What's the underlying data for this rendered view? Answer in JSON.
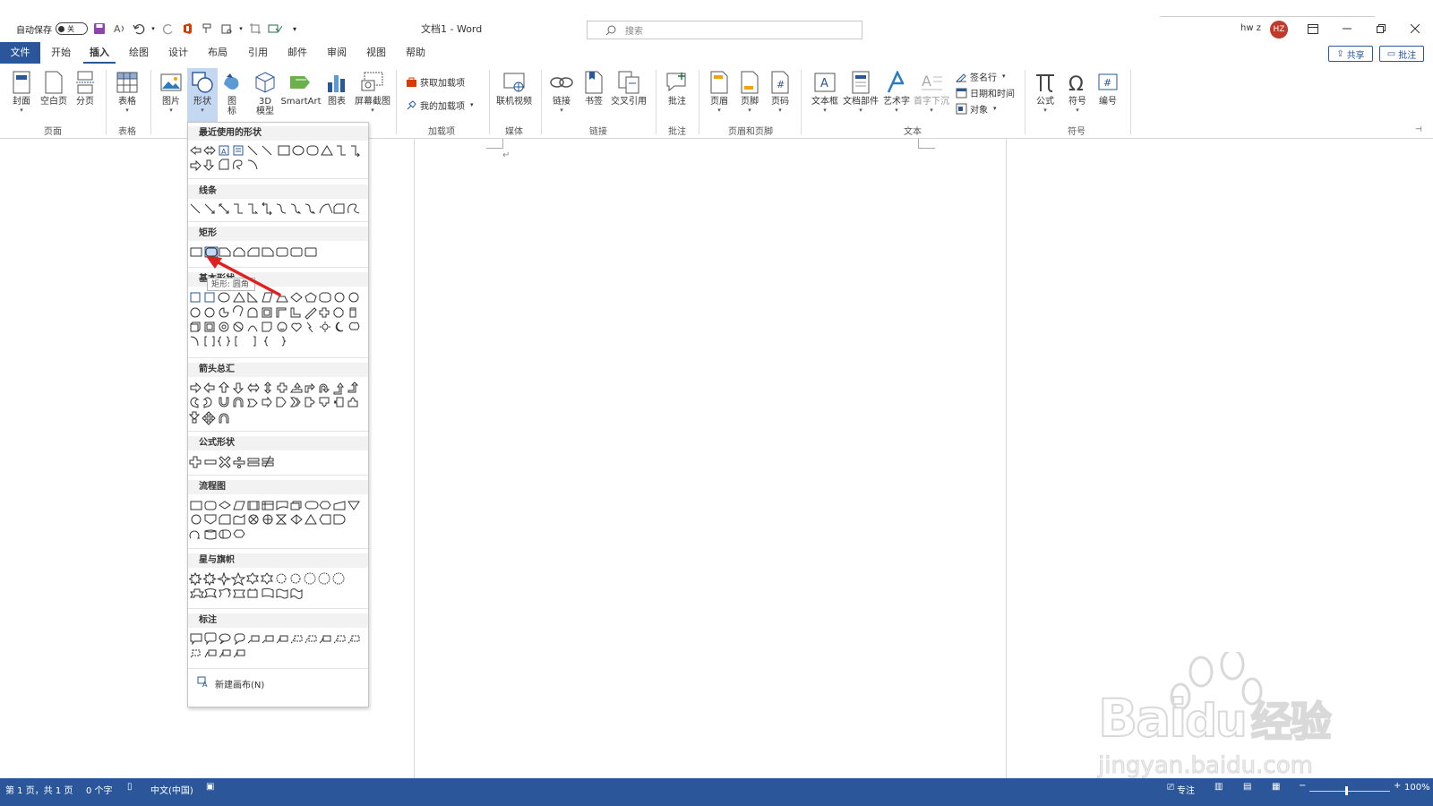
{
  "title_bar": {
    "autosave_label": "自动保存",
    "autosave_state": "关",
    "doc_title": "文档1 - Word",
    "search_placeholder": "搜索",
    "user_name": "hw z",
    "user_initials": "HZ",
    "avatar_color": "#c0392b"
  },
  "tabs": [
    "文件",
    "开始",
    "插入",
    "绘图",
    "设计",
    "布局",
    "引用",
    "邮件",
    "审阅",
    "视图",
    "帮助"
  ],
  "active_tab": "插入",
  "top_buttons": {
    "share": "共享",
    "comments": "批注"
  },
  "ribbon": {
    "pages": {
      "cover": "封面",
      "blank": "空白页",
      "break": "分页",
      "group": "页面"
    },
    "tables": {
      "table": "表格",
      "group": "表格"
    },
    "illustrations": {
      "picture": "图片",
      "shapes": "形状",
      "icons": "图标",
      "model3d": "3D 模型",
      "smartart": "SmartArt",
      "chart": "图表",
      "screenshot": "屏幕截图"
    },
    "addins": {
      "get": "获取加载项",
      "mine": "我的加载项",
      "group": "加载项"
    },
    "media": {
      "video": "联机视频",
      "group": "媒体"
    },
    "links": {
      "link": "链接",
      "bookmark": "书签",
      "crossref": "交叉引用",
      "group": "链接"
    },
    "comments": {
      "comment": "批注",
      "group": "批注"
    },
    "header_footer": {
      "header": "页眉",
      "footer": "页脚",
      "pagenum": "页码",
      "group": "页眉和页脚"
    },
    "text": {
      "textbox": "文本框",
      "parts": "文档部件",
      "wordart": "艺术字",
      "dropcap": "首字下沉",
      "signature": "签名行",
      "datetime": "日期和时间",
      "object": "对象",
      "group": "文本"
    },
    "symbols": {
      "equation": "公式",
      "symbol": "符号",
      "number": "编号",
      "group": "符号"
    }
  },
  "shapes_menu": {
    "sections": [
      "最近使用的形状",
      "线条",
      "矩形",
      "基本形状",
      "箭头总汇",
      "公式形状",
      "流程图",
      "星与旗帜",
      "标注"
    ],
    "tooltip": "矩形: 圆角",
    "new_canvas": "新建画布(N)"
  },
  "status_bar": {
    "page": "第 1 页，共 1 页",
    "words": "0 个字",
    "language": "中文(中国)",
    "focus": "专注",
    "zoom": "100%"
  },
  "watermark": {
    "line1": "Bai",
    "line2": "du",
    "cn": "经验",
    "url": "jingyan.baidu.com"
  },
  "colors": {
    "accent": "#2b579a",
    "selected": "#c5d8f1",
    "arrow": "#e02020"
  }
}
